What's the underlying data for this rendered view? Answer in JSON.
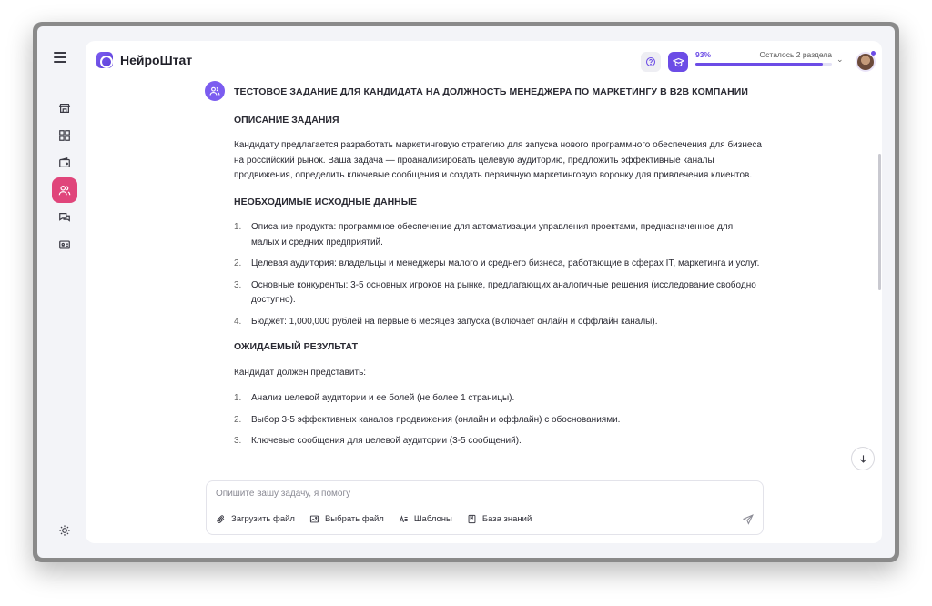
{
  "app": {
    "name": "НейроШтат"
  },
  "header": {
    "progress_percent_label": "93%",
    "progress_value": 0.93,
    "progress_remaining": "Осталось 2 раздела"
  },
  "colors": {
    "accent": "#6c4ce6",
    "active_nav": "#e0457b"
  },
  "sidebar": {
    "items": [
      {
        "icon": "store-icon"
      },
      {
        "icon": "widgets-icon"
      },
      {
        "icon": "wallet-icon"
      },
      {
        "icon": "users-icon",
        "active": true
      },
      {
        "icon": "chat-icon"
      },
      {
        "icon": "id-card-icon"
      }
    ],
    "bottom_icon": "sun-icon"
  },
  "message": {
    "title": "ТЕСТОВОЕ ЗАДАНИЕ ДЛЯ КАНДИДАТА НА ДОЛЖНОСТЬ МЕНЕДЖЕРА ПО МАРКЕТИНГУ В B2B КОМПАНИИ",
    "section1_heading": "ОПИСАНИЕ ЗАДАНИЯ",
    "section1_text": "Кандидату предлагается разработать маркетинговую стратегию для запуска нового программного обеспечения для бизнеса на российский рынок. Ваша задача — проанализировать целевую аудиторию, предложить эффективные каналы продвижения, определить ключевые сообщения и создать первичную маркетинговую воронку для привлечения клиентов.",
    "section2_heading": "НЕОБХОДИМЫЕ ИСХОДНЫЕ ДАННЫЕ",
    "section2_items": [
      {
        "num": "1.",
        "text": "Описание продукта: программное обеспечение для автоматизации управления проектами, предназначенное для малых и средних предприятий."
      },
      {
        "num": "2.",
        "text": "Целевая аудитория: владельцы и менеджеры малого и среднего бизнеса, работающие в сферах IT, маркетинга и услуг."
      },
      {
        "num": "3.",
        "text": "Основные конкуренты: 3-5 основных игроков на рынке, предлагающих аналогичные решения (исследование свободно доступно)."
      },
      {
        "num": "4.",
        "text": "Бюджет: 1,000,000 рублей на первые 6 месяцев запуска (включает онлайн и оффлайн каналы)."
      }
    ],
    "section3_heading": "ОЖИДАЕМЫЙ РЕЗУЛЬТАТ",
    "section3_intro": "Кандидат должен представить:",
    "section3_items": [
      {
        "num": "1.",
        "text": "Анализ целевой аудитории и ее болей (не более 1 страницы)."
      },
      {
        "num": "2.",
        "text": "Выбор 3-5 эффективных каналов продвижения (онлайн и оффлайн) с обоснованиями."
      },
      {
        "num": "3.",
        "text": "Ключевые сообщения для целевой аудитории (3-5 сообщений)."
      }
    ]
  },
  "composer": {
    "placeholder": "Опишите вашу задачу, я помогу",
    "upload_label": "Загрузить файл",
    "choose_label": "Выбрать файл",
    "templates_label": "Шаблоны",
    "knowledge_label": "База знаний"
  }
}
